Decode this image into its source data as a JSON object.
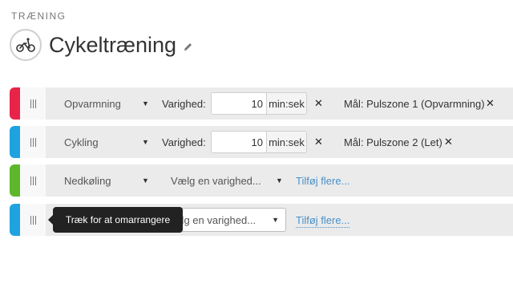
{
  "header": {
    "eyebrow": "TRÆNING",
    "title": "Cykeltræning",
    "avatar_icon": "bicycle-icon",
    "edit_icon": "pencil-icon"
  },
  "steps": [
    {
      "color": "#e8234a",
      "type": "Opvarmning",
      "duration_label": "Varighed:",
      "duration_value": "10",
      "duration_unit": "min:sek",
      "goal": "Mål: Pulszone 1 (Opvarmning)"
    },
    {
      "color": "#1fa3e0",
      "type": "Cykling",
      "duration_label": "Varighed:",
      "duration_value": "10",
      "duration_unit": "min:sek",
      "goal": "Mål: Pulszone 2 (Let)"
    },
    {
      "color": "#5cb82a",
      "type": "Nedkøling",
      "duration_select": "Vælg en varighed...",
      "add_more": "Tilføj flere..."
    },
    {
      "color": "#1fa3e0",
      "duration_select_visible": "ælg en varighed...",
      "add_more": "Tilføj flere..."
    }
  ],
  "tooltip": "Træk for at omarrangere"
}
